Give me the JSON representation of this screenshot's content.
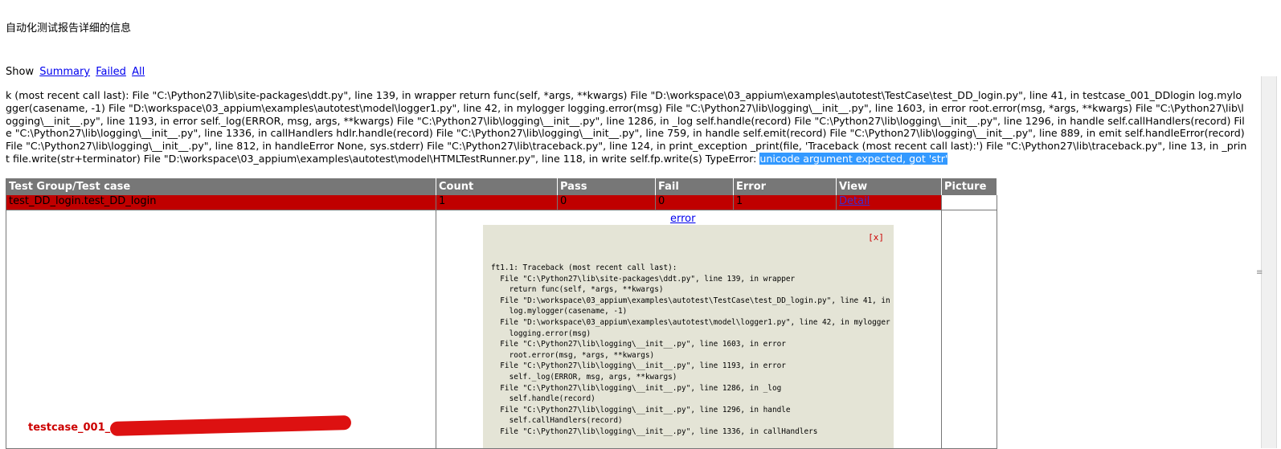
{
  "page": {
    "heading": "自动化测试报告详细的信息",
    "show_label": "Show",
    "filters": [
      "Summary",
      "Failed",
      "All"
    ],
    "error_message": "k (most recent call last): File \"C:\\Python27\\lib\\site-packages\\ddt.py\", line 139, in wrapper return func(self, *args, **kwargs) File \"D:\\workspace\\03_appium\\examples\\autotest\\TestCase\\test_DD_login.py\", line 41, in testcase_001_DDlogin log.mylogger(casename, -1) File \"D:\\workspace\\03_appium\\examples\\autotest\\model\\logger1.py\", line 42, in mylogger logging.error(msg) File \"C:\\Python27\\lib\\logging\\__init__.py\", line 1603, in error root.error(msg, *args, **kwargs) File \"C:\\Python27\\lib\\logging\\__init__.py\", line 1193, in error self._log(ERROR, msg, args, **kwargs) File \"C:\\Python27\\lib\\logging\\__init__.py\", line 1286, in _log self.handle(record) File \"C:\\Python27\\lib\\logging\\__init__.py\", line 1296, in handle self.callHandlers(record) File \"C:\\Python27\\lib\\logging\\__init__.py\", line 1336, in callHandlers hdlr.handle(record) File \"C:\\Python27\\lib\\logging\\__init__.py\", line 759, in handle self.emit(record) File \"C:\\Python27\\lib\\logging\\__init__.py\", line 889, in emit self.handleError(record) File \"C:\\Python27\\lib\\logging\\__init__.py\", line 812, in handleError None, sys.stderr) File \"C:\\Python27\\lib\\traceback.py\", line 124, in print_exception _print(file, 'Traceback (most recent call last):') File \"C:\\Python27\\lib\\traceback.py\", line 13, in _print file.write(str+terminator) File \"D:\\workspace\\03_appium\\examples\\autotest\\model\\HTMLTestRunner.py\", line 118, in write self.fp.write(s) TypeError: ",
    "error_highlight": "unicode argument expected, got 'str'"
  },
  "table": {
    "headers": [
      "Test Group/Test case",
      "Count",
      "Pass",
      "Fail",
      "Error",
      "View",
      "Picture"
    ],
    "fail_row": {
      "group": "test_DD_login.test_DD_login",
      "count": "1",
      "pass": "0",
      "fail": "0",
      "error": "1",
      "view": "Detail"
    },
    "detail": {
      "error_link": "error",
      "close_label": "[x]",
      "testcase_name": "testcase_001_",
      "traceback_lines": [
        "ft1.1: Traceback (most recent call last):",
        "  File \"C:\\Python27\\lib\\site-packages\\ddt.py\", line 139, in wrapper",
        "    return func(self, *args, **kwargs)",
        "  File \"D:\\workspace\\03_appium\\examples\\autotest\\TestCase\\test_DD_login.py\", line 41, in testcase_001_DDlogin",
        "    log.mylogger(casename, -1)",
        "  File \"D:\\workspace\\03_appium\\examples\\autotest\\model\\logger1.py\", line 42, in mylogger",
        "    logging.error(msg)",
        "  File \"C:\\Python27\\lib\\logging\\__init__.py\", line 1603, in error",
        "    root.error(msg, *args, **kwargs)",
        "  File \"C:\\Python27\\lib\\logging\\__init__.py\", line 1193, in error",
        "    self._log(ERROR, msg, args, **kwargs)",
        "  File \"C:\\Python27\\lib\\logging\\__init__.py\", line 1286, in _log",
        "    self.handle(record)",
        "  File \"C:\\Python27\\lib\\logging\\__init__.py\", line 1296, in handle",
        "    self.callHandlers(record)",
        "  File \"C:\\Python27\\lib\\logging\\__init__.py\", line 1336, in callHandlers"
      ]
    }
  },
  "colors": {
    "fail_row": "#c00000",
    "header_bg": "#777777",
    "popup_bg": "#e4e4d6",
    "highlight": "#3399ff"
  }
}
